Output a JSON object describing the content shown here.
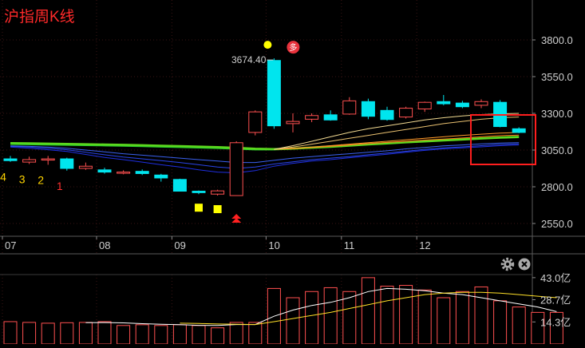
{
  "title": "沪指周K线",
  "colors": {
    "up": "#ff5050",
    "down": "#00e5ee",
    "title": "#ff2a2a",
    "grid": "#3a1414",
    "axis_text": "#cfcfcf",
    "highlight": "#ff1e1e",
    "badge": "#e8323c",
    "marker": "#ffff00"
  },
  "badge_label": "多",
  "icons": [
    "gear-icon",
    "close-icon"
  ],
  "chart_data": [
    {
      "type": "candlestick",
      "title": "沪指周K线",
      "ylim": [
        2500,
        3900
      ],
      "y_ticks": [
        "3800.0",
        "3550.0",
        "3300.0",
        "3050.0",
        "2800.0",
        "2550.0"
      ],
      "x_ticks": [
        {
          "label": "07",
          "index": 0
        },
        {
          "label": "08",
          "index": 5
        },
        {
          "label": "09",
          "index": 9
        },
        {
          "label": "10",
          "index": 14
        },
        {
          "label": "11",
          "index": 18
        },
        {
          "label": "12",
          "index": 22
        }
      ],
      "max_label": {
        "text": "3674.40",
        "index": 14
      },
      "count_labels": [
        {
          "text": "4",
          "index": 0,
          "color": "#ffd400"
        },
        {
          "text": "3",
          "index": 1,
          "color": "#ffd400"
        },
        {
          "text": "2",
          "index": 2,
          "color": "#ffd400"
        },
        {
          "text": "1",
          "index": 3,
          "color": "#ff3030"
        }
      ],
      "markers": [
        {
          "type": "square",
          "index": 10,
          "color": "#ffff00"
        },
        {
          "type": "square",
          "index": 11,
          "color": "#ffff00"
        },
        {
          "type": "double-chevron-up",
          "index": 12,
          "color": "#ff2020"
        },
        {
          "type": "dot",
          "index": 14,
          "color": "#ffff00"
        },
        {
          "type": "badge",
          "index": 15,
          "text": "多"
        }
      ],
      "candles": [
        {
          "open": 2990,
          "high": 3010,
          "low": 2970,
          "close": 2978
        },
        {
          "open": 2968,
          "high": 3005,
          "low": 2955,
          "close": 2985
        },
        {
          "open": 2985,
          "high": 3010,
          "low": 2950,
          "close": 2990
        },
        {
          "open": 2990,
          "high": 2998,
          "low": 2910,
          "close": 2925
        },
        {
          "open": 2925,
          "high": 2965,
          "low": 2915,
          "close": 2940
        },
        {
          "open": 2915,
          "high": 2930,
          "low": 2890,
          "close": 2900
        },
        {
          "open": 2895,
          "high": 2912,
          "low": 2885,
          "close": 2900
        },
        {
          "open": 2905,
          "high": 2918,
          "low": 2880,
          "close": 2890
        },
        {
          "open": 2880,
          "high": 2888,
          "low": 2835,
          "close": 2860
        },
        {
          "open": 2850,
          "high": 2855,
          "low": 2770,
          "close": 2770
        },
        {
          "open": 2770,
          "high": 2775,
          "low": 2750,
          "close": 2760
        },
        {
          "open": 2750,
          "high": 2780,
          "low": 2740,
          "close": 2772
        },
        {
          "open": 2740,
          "high": 3110,
          "low": 2740,
          "close": 3100
        },
        {
          "open": 3170,
          "high": 3320,
          "low": 3150,
          "close": 3310
        },
        {
          "open": 3660,
          "high": 3674.4,
          "low": 3195,
          "close": 3215
        },
        {
          "open": 3230,
          "high": 3300,
          "low": 3170,
          "close": 3245
        },
        {
          "open": 3260,
          "high": 3300,
          "low": 3240,
          "close": 3285
        },
        {
          "open": 3290,
          "high": 3320,
          "low": 3250,
          "close": 3255
        },
        {
          "open": 3295,
          "high": 3410,
          "low": 3290,
          "close": 3385
        },
        {
          "open": 3380,
          "high": 3400,
          "low": 3260,
          "close": 3280
        },
        {
          "open": 3320,
          "high": 3345,
          "low": 3250,
          "close": 3258
        },
        {
          "open": 3275,
          "high": 3345,
          "low": 3265,
          "close": 3335
        },
        {
          "open": 3330,
          "high": 3380,
          "low": 3310,
          "close": 3375
        },
        {
          "open": 3380,
          "high": 3425,
          "low": 3355,
          "close": 3365
        },
        {
          "open": 3370,
          "high": 3385,
          "low": 3335,
          "close": 3345
        },
        {
          "open": 3355,
          "high": 3395,
          "low": 3335,
          "close": 3380
        },
        {
          "open": 3375,
          "high": 3390,
          "low": 3205,
          "close": 3210
        },
        {
          "open": 3195,
          "high": 3205,
          "low": 3165,
          "close": 3170
        }
      ],
      "ma_ribbons": [
        {
          "name": "",
          "color": "#1f2fe0",
          "values": [
            3070,
            3062,
            3052,
            3040,
            3020,
            3000,
            2985,
            2968,
            2950,
            2935,
            2915,
            2900,
            2895,
            2910,
            2940,
            2960,
            2975,
            2985,
            2998,
            3010,
            3022,
            3035,
            3048,
            3058,
            3065,
            3072,
            3080,
            3085
          ]
        },
        {
          "name": "",
          "color": "#2a45e8",
          "values": [
            3075,
            3070,
            3062,
            3052,
            3035,
            3018,
            3002,
            2990,
            2978,
            2965,
            2950,
            2935,
            2925,
            2935,
            2955,
            2970,
            2985,
            2995,
            3005,
            3018,
            3030,
            3042,
            3055,
            3065,
            3072,
            3080,
            3088,
            3092
          ]
        },
        {
          "name": "",
          "color": "#3a60ee",
          "values": [
            3078,
            3075,
            3070,
            3062,
            3050,
            3038,
            3025,
            3015,
            3005,
            2995,
            2985,
            2975,
            2965,
            2965,
            2980,
            2995,
            3005,
            3015,
            3025,
            3035,
            3045,
            3058,
            3068,
            3078,
            3085,
            3092,
            3098,
            3100
          ]
        },
        {
          "name": "",
          "color": "#2bd02b",
          "values": [
            3092,
            3090,
            3088,
            3086,
            3084,
            3082,
            3080,
            3077,
            3074,
            3071,
            3068,
            3064,
            3060,
            3055,
            3055,
            3060,
            3068,
            3075,
            3082,
            3090,
            3098,
            3105,
            3112,
            3118,
            3124,
            3130,
            3136,
            3140
          ]
        },
        {
          "name": "",
          "color": "#5cd81e",
          "values": [
            3098,
            3096,
            3094,
            3092,
            3090,
            3088,
            3086,
            3083,
            3080,
            3077,
            3074,
            3070,
            3066,
            3060,
            3057,
            3060,
            3066,
            3072,
            3080,
            3088,
            3095,
            3102,
            3108,
            3115,
            3121,
            3128,
            3134,
            3138
          ]
        },
        {
          "name": "",
          "color": "#ff7a1a",
          "values": [
            null,
            null,
            null,
            null,
            null,
            null,
            null,
            null,
            null,
            null,
            null,
            null,
            null,
            null,
            3055,
            3060,
            3068,
            3076,
            3085,
            3094,
            3102,
            3110,
            3118,
            3125,
            3132,
            3140,
            3148,
            3152
          ]
        },
        {
          "name": "",
          "color": "#ff9a2a",
          "values": [
            null,
            null,
            null,
            null,
            null,
            null,
            null,
            null,
            null,
            null,
            null,
            null,
            null,
            null,
            3055,
            3062,
            3070,
            3080,
            3090,
            3100,
            3110,
            3120,
            3130,
            3140,
            3150,
            3158,
            3165,
            3170
          ]
        },
        {
          "name": "",
          "color": "#e8c070",
          "values": [
            null,
            null,
            null,
            null,
            null,
            null,
            null,
            null,
            null,
            null,
            null,
            null,
            null,
            null,
            3055,
            3070,
            3090,
            3110,
            3130,
            3150,
            3170,
            3190,
            3210,
            3230,
            3245,
            3260,
            3270,
            3275
          ]
        },
        {
          "name": "",
          "color": "#f0d890",
          "values": [
            null,
            null,
            null,
            null,
            null,
            null,
            null,
            null,
            null,
            null,
            null,
            null,
            null,
            null,
            3055,
            3080,
            3110,
            3140,
            3170,
            3195,
            3215,
            3235,
            3255,
            3270,
            3282,
            3292,
            3297,
            3300
          ]
        }
      ]
    },
    {
      "type": "bar",
      "title": "",
      "y_ticks": [
        "43.0亿",
        "28.7亿",
        "14.3亿"
      ],
      "ylim": [
        0,
        45
      ],
      "values": [
        14.5,
        14.0,
        13.5,
        13.8,
        14.0,
        14.5,
        12.0,
        12.5,
        12.0,
        12.5,
        12.0,
        10.5,
        14.0,
        14.0,
        36.0,
        30.0,
        34.0,
        36.5,
        34.0,
        43.0,
        37.5,
        38.0,
        35.0,
        30.0,
        34.0,
        37.0,
        28.0,
        24.0,
        20.5,
        20.5
      ],
      "ma_lines": [
        {
          "name": "",
          "color": "#ffffff",
          "values": [
            null,
            null,
            null,
            null,
            13.8,
            13.9,
            13.7,
            13.2,
            12.8,
            12.5,
            12.1,
            12.0,
            12.6,
            12.6,
            18.0,
            22.0,
            25.0,
            27.0,
            30.0,
            34.0,
            36.0,
            35.5,
            34.5,
            33.0,
            32.0,
            30.0,
            28.0,
            26.0,
            24.0,
            21.0
          ]
        },
        {
          "name": "",
          "color": "#ffe028",
          "values": [
            null,
            null,
            null,
            null,
            null,
            null,
            null,
            null,
            null,
            13.5,
            13.3,
            13.0,
            12.8,
            12.6,
            14.5,
            16.5,
            18.5,
            20.5,
            23.0,
            25.5,
            28.0,
            30.0,
            32.0,
            33.0,
            33.5,
            33.5,
            33.0,
            32.0,
            31.0,
            30.0
          ]
        }
      ]
    }
  ]
}
